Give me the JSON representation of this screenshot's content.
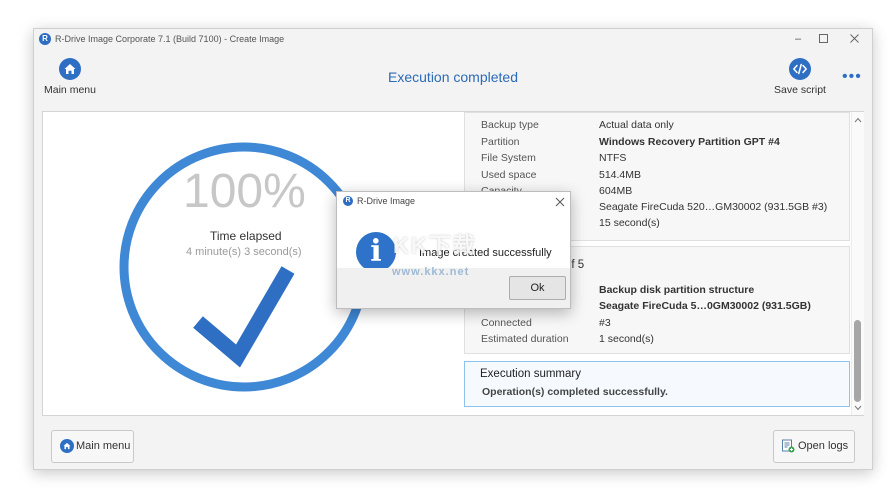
{
  "window": {
    "title": "R-Drive Image Corporate 7.1 (Build 7100) - Create Image",
    "app_icon_letter": "R"
  },
  "toolbar": {
    "main_menu_label": "Main menu",
    "title": "Execution completed",
    "save_script_label": "Save script",
    "more_label": "•••"
  },
  "progress": {
    "percent_text": "100%",
    "percent": 100,
    "time_elapsed_label": "Time elapsed",
    "time_elapsed_value": "4 minute(s) 3 second(s)"
  },
  "details_panel": {
    "rows": [
      {
        "key": "Backup type",
        "value": "Actual data only",
        "bold": false
      },
      {
        "key": "Partition",
        "value": "Windows Recovery Partition GPT #4",
        "bold": true
      },
      {
        "key": "File System",
        "value": "NTFS",
        "bold": false
      },
      {
        "key": "Used space",
        "value": "514.4MB",
        "bold": false
      },
      {
        "key": "Capacity",
        "value": "604MB",
        "bold": false
      },
      {
        "key": "",
        "value": "Seagate FireCuda 520…GM30002 (931.5GB #3)",
        "bold": false
      },
      {
        "key": "",
        "value": "15 second(s)",
        "bold": false
      }
    ]
  },
  "operation_panel": {
    "header_partial": "of 5",
    "rows": [
      {
        "key": "",
        "value": "Backup disk partition structure",
        "bold": true
      },
      {
        "key": "",
        "value": "Seagate FireCuda 5…0GM30002 (931.5GB)",
        "bold": true
      },
      {
        "key": "Connected",
        "value": "#3",
        "bold": false
      },
      {
        "key": "Estimated duration",
        "value": "1 second(s)",
        "bold": false
      }
    ]
  },
  "summary": {
    "title": "Execution summary",
    "text": "Operation(s) completed successfully."
  },
  "bottom": {
    "main_menu_label": "Main menu",
    "open_logs_label": "Open logs"
  },
  "dialog": {
    "title": "R-Drive Image",
    "message": "Image created successfully",
    "ok_label": "Ok",
    "info_glyph": "i"
  },
  "watermark": {
    "brand": "KK下载",
    "url": "www.kkx.net"
  },
  "colors": {
    "accent": "#2e6fc4",
    "progress_ring": "#3f88d6",
    "check": "#2e6fc4"
  }
}
